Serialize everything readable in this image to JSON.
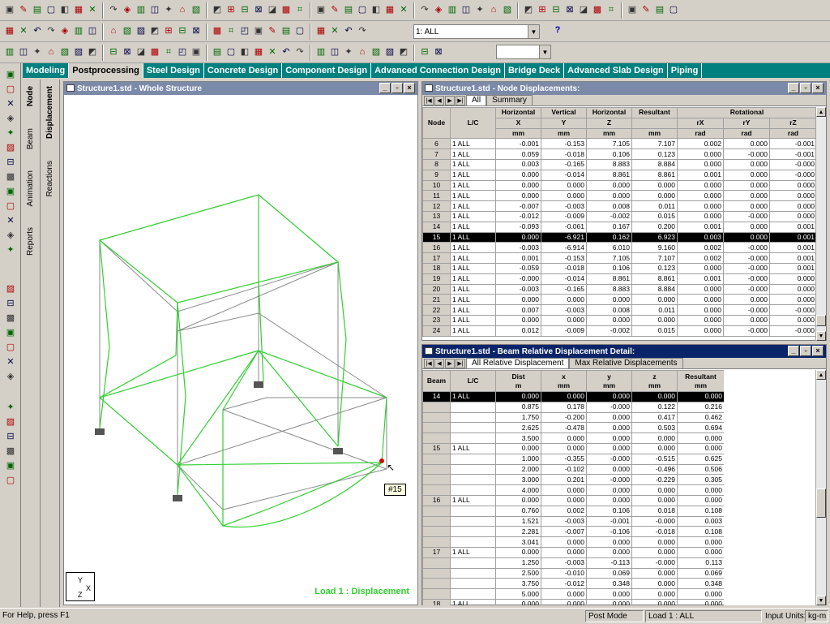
{
  "tabs": [
    "Modeling",
    "Postprocessing",
    "Steel Design",
    "Concrete Design",
    "Component Design",
    "Advanced Connection Design",
    "Bridge Deck",
    "Advanced Slab Design",
    "Piping"
  ],
  "active_tab": 1,
  "load_case_combo": "1: ALL",
  "help_icon": "?",
  "side_tabs_left": [
    "Node",
    "Beam",
    "Animation",
    "Reports"
  ],
  "side_tabs_right": [
    "Displacement",
    "Reactions"
  ],
  "structure_window": {
    "title": "Structure1.std - Whole Structure",
    "load_label": "Load 1 : Displacement",
    "node_tooltip": "#15",
    "axis_y": "Y",
    "axis_x": "X",
    "axis_z": "Z"
  },
  "node_window": {
    "title": "Structure1.std - Node Displacements:",
    "tabs": [
      "All",
      "Summary"
    ],
    "header_groups": [
      "Horizontal",
      "Vertical",
      "Horizontal",
      "Resultant",
      "Rotational"
    ],
    "col_node": "Node",
    "col_lc": "L/C",
    "col_axes": [
      "X",
      "Y",
      "Z",
      "",
      "rX",
      "rY",
      "rZ"
    ],
    "col_units": [
      "mm",
      "mm",
      "mm",
      "mm",
      "rad",
      "rad",
      "rad"
    ],
    "rows": [
      [
        "6",
        "1 ALL",
        "-0.001",
        "-0.153",
        "7.105",
        "7.107",
        "0.002",
        "0.000",
        "-0.001"
      ],
      [
        "7",
        "1 ALL",
        "0.059",
        "-0.018",
        "0.106",
        "0.123",
        "0.000",
        "-0.000",
        "-0.001"
      ],
      [
        "8",
        "1 ALL",
        "0.003",
        "-0.165",
        "8.883",
        "8.884",
        "0.000",
        "0.000",
        "-0.000"
      ],
      [
        "9",
        "1 ALL",
        "0.000",
        "-0.014",
        "8.861",
        "8.861",
        "0.001",
        "0.000",
        "-0.000"
      ],
      [
        "10",
        "1 ALL",
        "0.000",
        "0.000",
        "0.000",
        "0.000",
        "0.000",
        "0.000",
        "0.000"
      ],
      [
        "11",
        "1 ALL",
        "0.000",
        "0.000",
        "0.000",
        "0.000",
        "0.000",
        "0.000",
        "0.000"
      ],
      [
        "12",
        "1 ALL",
        "-0.007",
        "-0.003",
        "0.008",
        "0.011",
        "0.000",
        "0.000",
        "0.000"
      ],
      [
        "13",
        "1 ALL",
        "-0.012",
        "-0.009",
        "-0.002",
        "0.015",
        "0.000",
        "-0.000",
        "0.000"
      ],
      [
        "14",
        "1 ALL",
        "-0.093",
        "-0.061",
        "0.167",
        "0.200",
        "0.001",
        "0.000",
        "0.001"
      ],
      [
        "15",
        "1 ALL",
        "0.000",
        "-6.921",
        "0.162",
        "6.923",
        "0.003",
        "0.000",
        "0.001"
      ],
      [
        "16",
        "1 ALL",
        "-0.003",
        "-6.914",
        "6.010",
        "9.160",
        "0.002",
        "-0.000",
        "0.001"
      ],
      [
        "17",
        "1 ALL",
        "0.001",
        "-0.153",
        "7.105",
        "7.107",
        "0.002",
        "-0.000",
        "0.001"
      ],
      [
        "18",
        "1 ALL",
        "-0.059",
        "-0.018",
        "0.106",
        "0.123",
        "0.000",
        "-0.000",
        "0.001"
      ],
      [
        "19",
        "1 ALL",
        "-0.000",
        "-0.014",
        "8.861",
        "8.861",
        "0.001",
        "-0.000",
        "0.000"
      ],
      [
        "20",
        "1 ALL",
        "-0.003",
        "-0.165",
        "8.883",
        "8.884",
        "0.000",
        "-0.000",
        "0.000"
      ],
      [
        "21",
        "1 ALL",
        "0.000",
        "0.000",
        "0.000",
        "0.000",
        "0.000",
        "0.000",
        "0.000"
      ],
      [
        "22",
        "1 ALL",
        "0.007",
        "-0.003",
        "0.008",
        "0.011",
        "0.000",
        "-0.000",
        "-0.000"
      ],
      [
        "23",
        "1 ALL",
        "0.000",
        "0.000",
        "0.000",
        "0.000",
        "0.000",
        "0.000",
        "0.000"
      ],
      [
        "24",
        "1 ALL",
        "0.012",
        "-0.009",
        "-0.002",
        "0.015",
        "0.000",
        "-0.000",
        "-0.000"
      ]
    ],
    "selected_row": 9
  },
  "beam_window": {
    "title": "Structure1.std - Beam Relative Displacement Detail:",
    "tabs": [
      "All Relative Displacement",
      "Max Relative Displacements"
    ],
    "cols": [
      "Beam",
      "L/C",
      "Dist",
      "x",
      "y",
      "z",
      "Resultant"
    ],
    "units": [
      "",
      "",
      "m",
      "mm",
      "mm",
      "mm",
      "mm"
    ],
    "rows": [
      [
        "14",
        "1 ALL",
        "0.000",
        "0.000",
        "0.000",
        "0.000",
        "0.000"
      ],
      [
        "",
        "",
        "0.875",
        "0.178",
        "-0.000",
        "0.122",
        "0.216"
      ],
      [
        "",
        "",
        "1.750",
        "-0.200",
        "0.000",
        "0.417",
        "0.462"
      ],
      [
        "",
        "",
        "2.625",
        "-0.478",
        "0.000",
        "0.503",
        "0.694"
      ],
      [
        "",
        "",
        "3.500",
        "0.000",
        "0.000",
        "0.000",
        "0.000"
      ],
      [
        "15",
        "1 ALL",
        "0.000",
        "0.000",
        "0.000",
        "0.000",
        "0.000"
      ],
      [
        "",
        "",
        "1.000",
        "-0.355",
        "-0.000",
        "-0.515",
        "0.625"
      ],
      [
        "",
        "",
        "2.000",
        "-0.102",
        "0.000",
        "-0.496",
        "0.506"
      ],
      [
        "",
        "",
        "3.000",
        "0.201",
        "-0.000",
        "-0.229",
        "0.305"
      ],
      [
        "",
        "",
        "4.000",
        "0.000",
        "0.000",
        "0.000",
        "0.000"
      ],
      [
        "16",
        "1 ALL",
        "0.000",
        "0.000",
        "0.000",
        "0.000",
        "0.000"
      ],
      [
        "",
        "",
        "0.760",
        "0.002",
        "0.106",
        "0.018",
        "0.108"
      ],
      [
        "",
        "",
        "1.521",
        "-0.003",
        "-0.001",
        "-0.000",
        "0.003"
      ],
      [
        "",
        "",
        "2.281",
        "-0.007",
        "-0.106",
        "-0.018",
        "0.108"
      ],
      [
        "",
        "",
        "3.041",
        "0.000",
        "0.000",
        "0.000",
        "0.000"
      ],
      [
        "17",
        "1 ALL",
        "0.000",
        "0.000",
        "0.000",
        "0.000",
        "0.000"
      ],
      [
        "",
        "",
        "1.250",
        "-0.003",
        "-0.113",
        "-0.000",
        "0.113"
      ],
      [
        "",
        "",
        "2.500",
        "-0.010",
        "0.069",
        "0.000",
        "0.069"
      ],
      [
        "",
        "",
        "3.750",
        "-0.012",
        "0.348",
        "0.000",
        "0.348"
      ],
      [
        "",
        "",
        "5.000",
        "0.000",
        "0.000",
        "0.000",
        "0.000"
      ],
      [
        "18",
        "1 ALL",
        "0.000",
        "0.000",
        "0.000",
        "0.000",
        "0.000"
      ]
    ],
    "selected_row": 0
  },
  "status": {
    "help": "For Help, press F1",
    "mode": "Post Mode",
    "load": "Load 1 : ALL",
    "units_label": "Input Units:",
    "units_value": "kg-m"
  }
}
